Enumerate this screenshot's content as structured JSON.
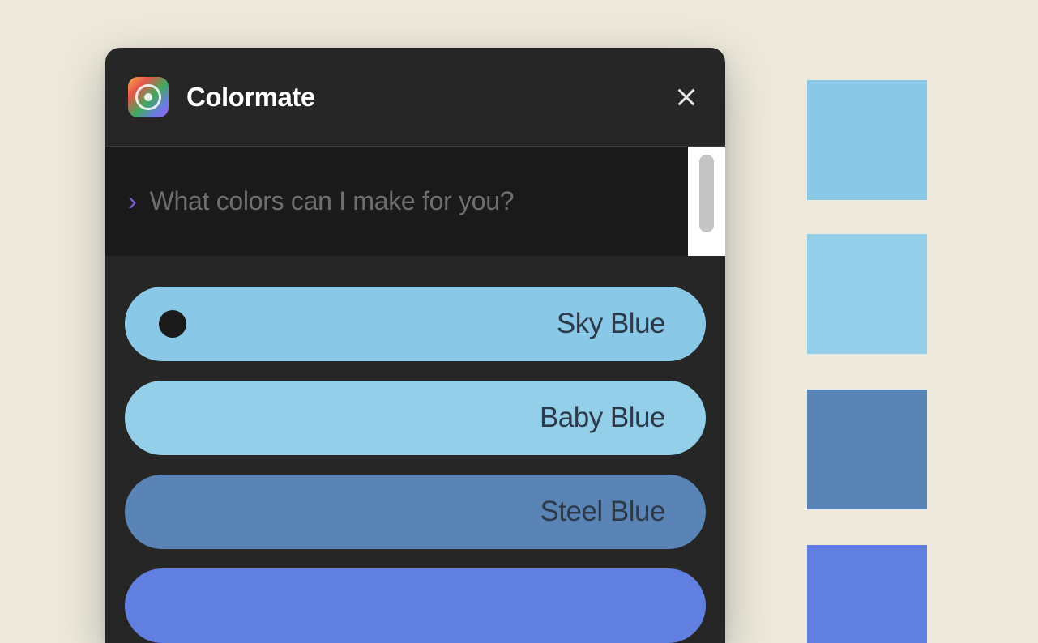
{
  "app": {
    "title": "Colormate"
  },
  "input": {
    "placeholder": "What colors can I make for you?"
  },
  "colors": [
    {
      "label": "Sky Blue",
      "hex": "#8ac8e8",
      "labelColor": "#2d3a4a",
      "selected": true
    },
    {
      "label": "Baby Blue",
      "hex": "#94cfea",
      "labelColor": "#2d3a4a",
      "selected": false
    },
    {
      "label": "Steel Blue",
      "hex": "#5a84b5",
      "labelColor": "#1a1a1a",
      "selected": false
    },
    {
      "label": "",
      "hex": "#607fe0",
      "labelColor": "#1a1a1a",
      "selected": false
    }
  ],
  "swatches": [
    "#8ac8e8",
    "#94cfea",
    "#5a84b5",
    "#607fe0"
  ]
}
